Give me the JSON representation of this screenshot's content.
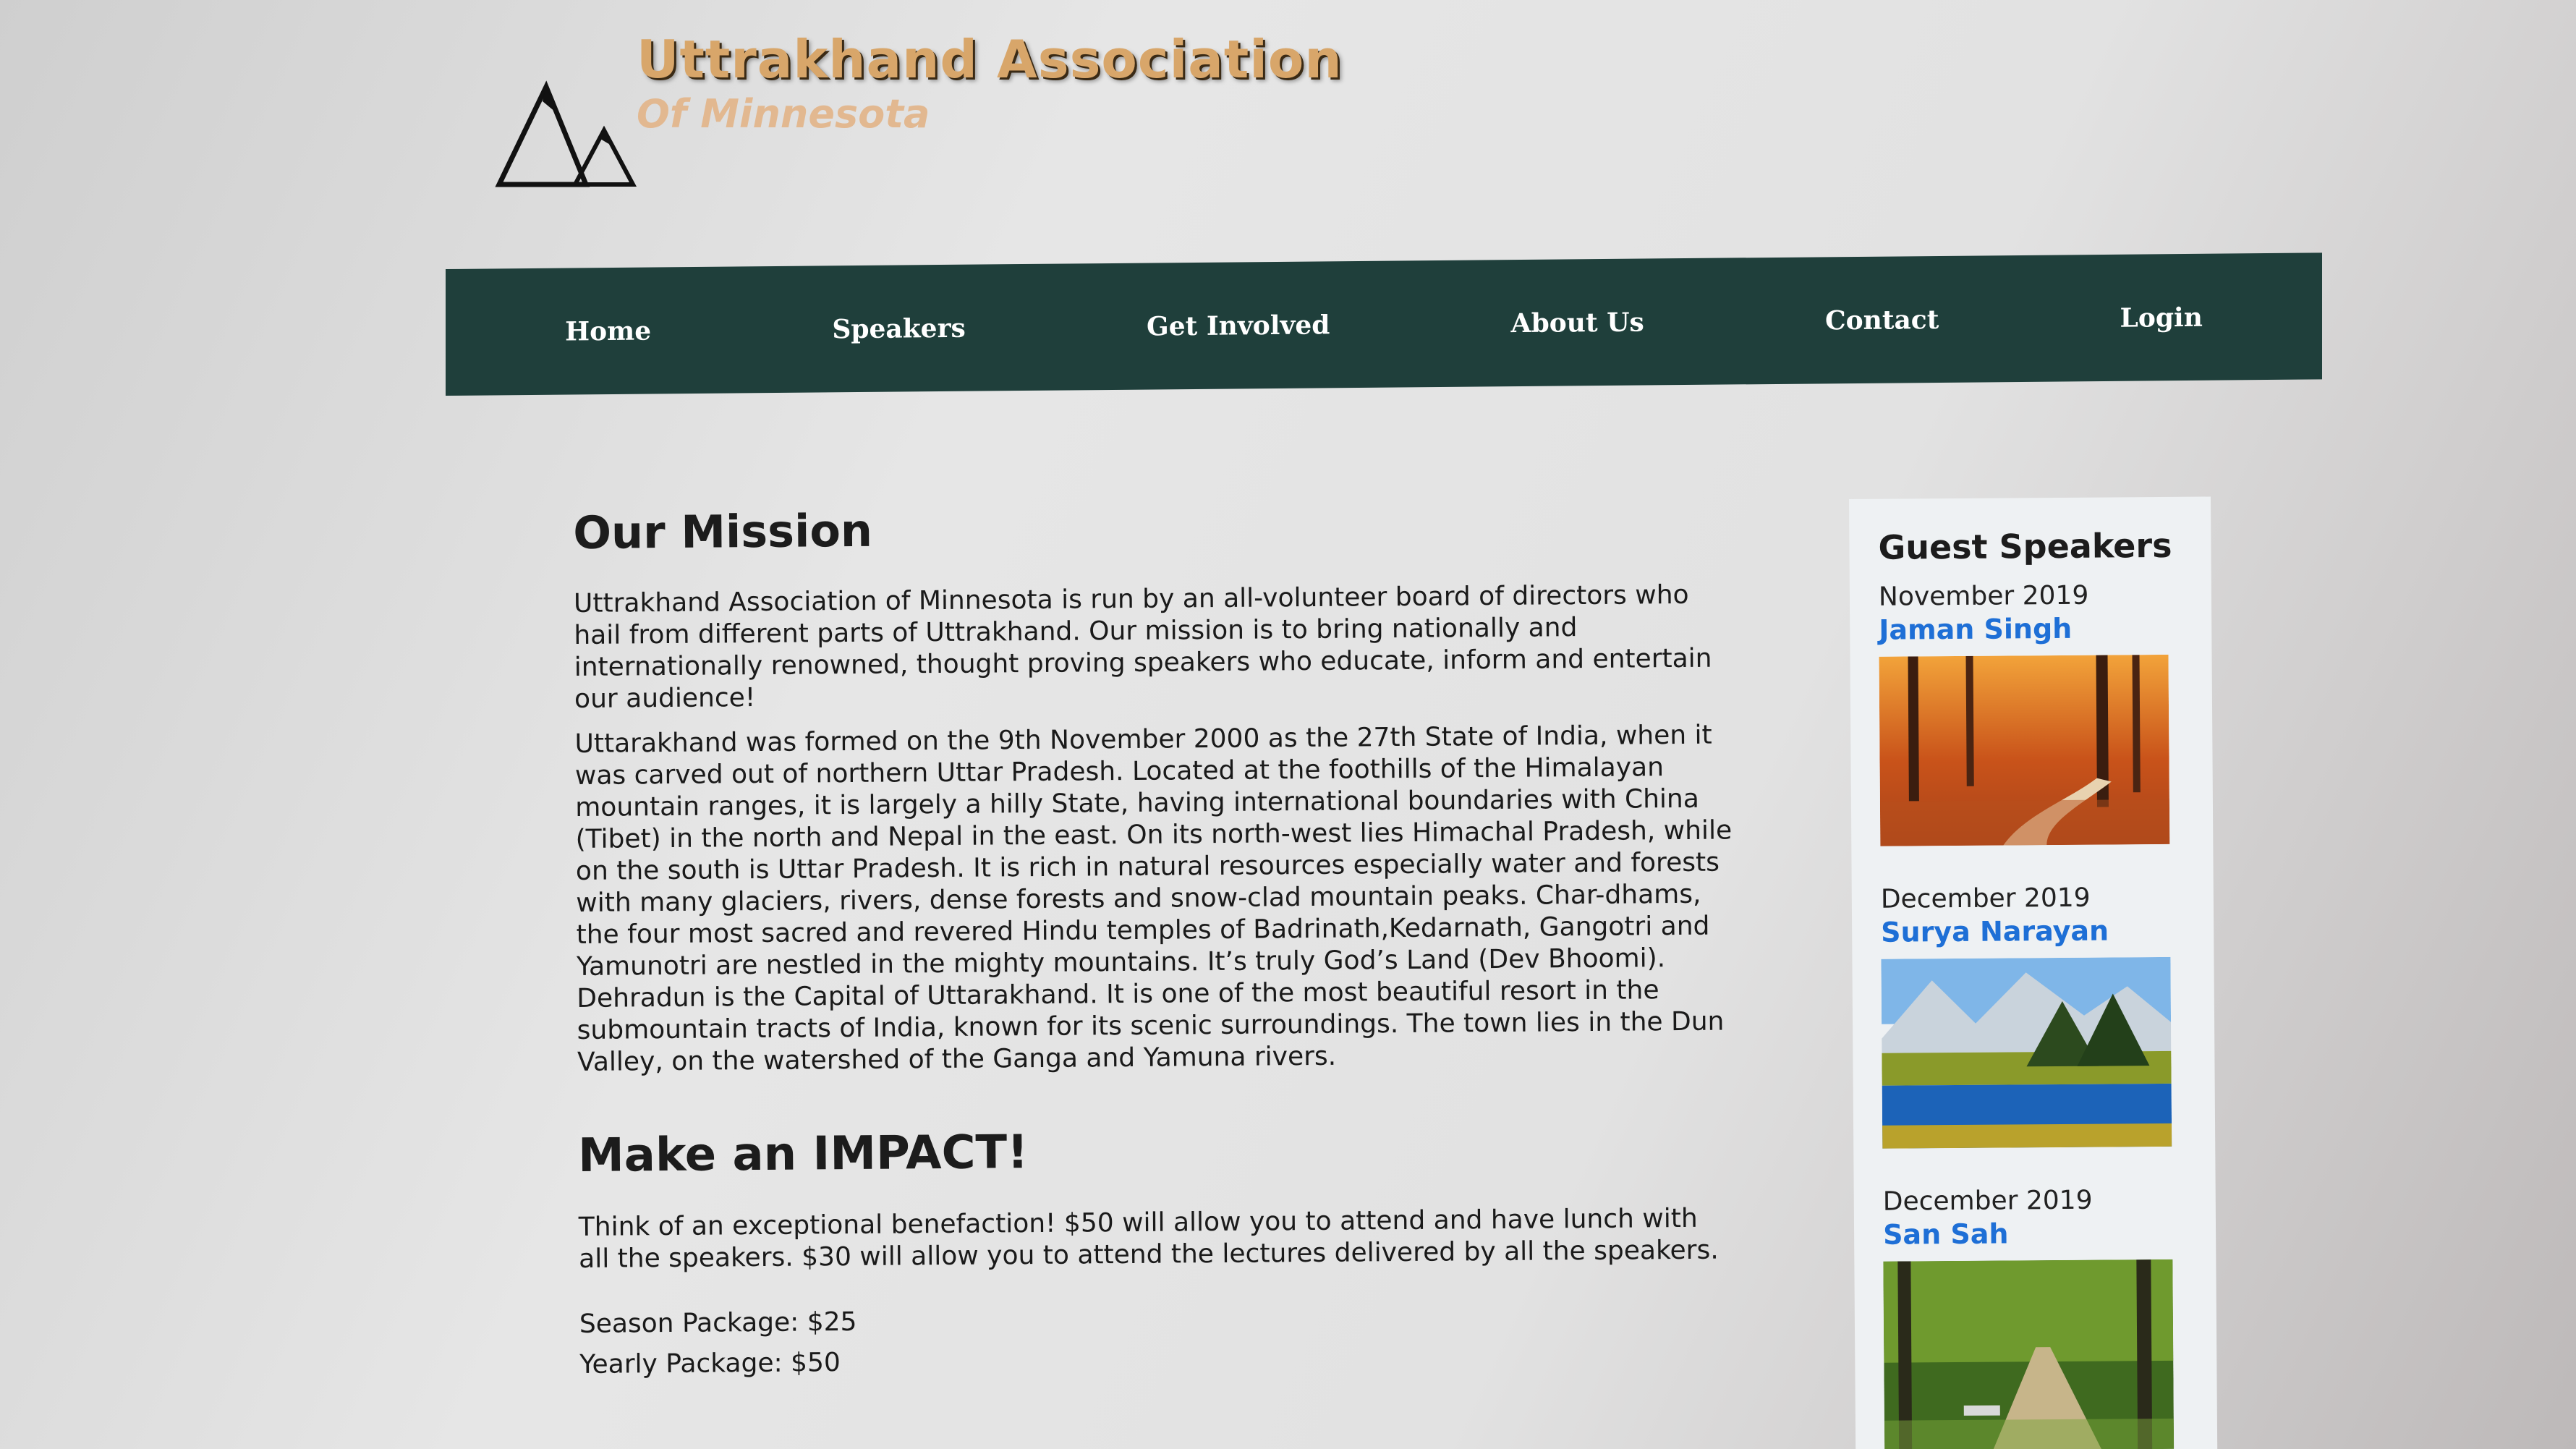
{
  "header": {
    "title": "Uttrakhand Association",
    "subtitle": "Of Minnesota",
    "logo_icon": "mountains-icon"
  },
  "nav": {
    "items": [
      {
        "label": "Home"
      },
      {
        "label": "Speakers"
      },
      {
        "label": "Get Involved"
      },
      {
        "label": "About Us"
      },
      {
        "label": "Contact"
      },
      {
        "label": "Login"
      }
    ],
    "background_color": "#1f3f3b"
  },
  "mission": {
    "heading": "Our Mission",
    "paragraph1": "Uttrakhand Association of Minnesota is run by an all-volunteer board of directors who hail from different parts of Uttrakhand. Our mission is to bring nationally and internationally renowned, thought proving speakers who educate, inform and entertain our audience!",
    "paragraph2": "Uttarakhand was formed on the 9th November 2000 as the 27th State of India, when it was carved out of northern Uttar Pradesh. Located at the foothills of the Himalayan mountain ranges, it is largely a hilly State, having international boundaries with China (Tibet) in the north and Nepal in the east. On its north-west lies Himachal Pradesh, while on the south is Uttar Pradesh. It is rich in natural resources especially water and forests with many glaciers, rivers, dense forests and snow-clad mountain peaks. Char-dhams, the four most sacred and revered Hindu temples of Badrinath,Kedarnath, Gangotri and Yamunotri are nestled in the mighty mountains. It’s truly God’s Land (Dev Bhoomi). Dehradun is the Capital of Uttarakhand. It is one of the most beautiful resort in the submountain tracts of India, known for its scenic surroundings. The town lies in the Dun Valley, on the watershed of the Ganga and Yamuna rivers."
  },
  "impact": {
    "heading": "Make an IMPACT!",
    "paragraph": "Think of an exceptional benefaction! $50 will allow you to attend and have lunch with all the speakers. $30 will allow you to attend the lectures delivered by all the speakers.",
    "season_package": "Season Package: $25",
    "yearly_package": "Yearly Package: $50"
  },
  "sidebar": {
    "heading": "Guest Speakers",
    "speakers": [
      {
        "date": "November 2019",
        "name": "Jaman Singh",
        "image": "autumn-forest-image"
      },
      {
        "date": "December 2019",
        "name": "Surya Narayan",
        "image": "mountain-lake-image"
      },
      {
        "date": "December 2019",
        "name": "San Sah",
        "image": "park-path-image"
      }
    ],
    "link_color": "#1e6fd6"
  }
}
